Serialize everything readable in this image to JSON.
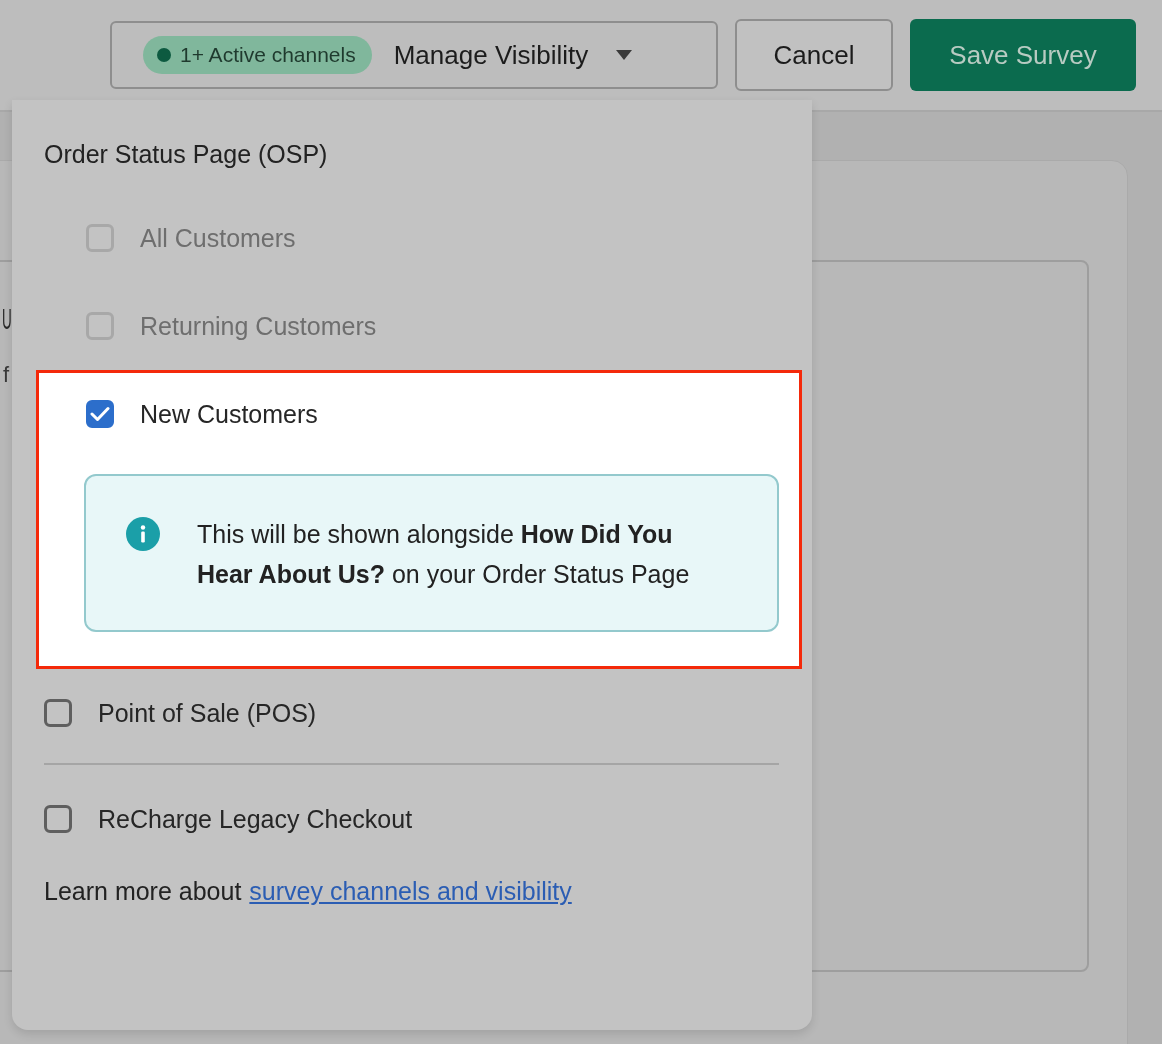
{
  "header": {
    "channels_badge": "1+ Active channels",
    "visibility_button": "Manage Visibility",
    "cancel_button": "Cancel",
    "save_button": "Save Survey"
  },
  "background": {
    "heading_fragment": "U",
    "description_fragment": "f"
  },
  "visibility_menu": {
    "section_title": "Order Status Page (OSP)",
    "options": [
      {
        "label": "All Customers",
        "checked": false,
        "disabled": true,
        "highlighted": false
      },
      {
        "label": "Returning Customers",
        "checked": false,
        "disabled": true,
        "highlighted": false
      },
      {
        "label": "New Customers",
        "checked": true,
        "disabled": false,
        "highlighted": true,
        "info": "This will be shown alongside **How Did You Hear About Us?** on your Order Status Page"
      }
    ],
    "channels": [
      {
        "label": "Point of Sale (POS)",
        "checked": false
      },
      {
        "label": "ReCharge Legacy Checkout",
        "checked": false
      }
    ],
    "footer": {
      "text": "Learn more about",
      "link": "survey channels and visibility"
    }
  }
}
